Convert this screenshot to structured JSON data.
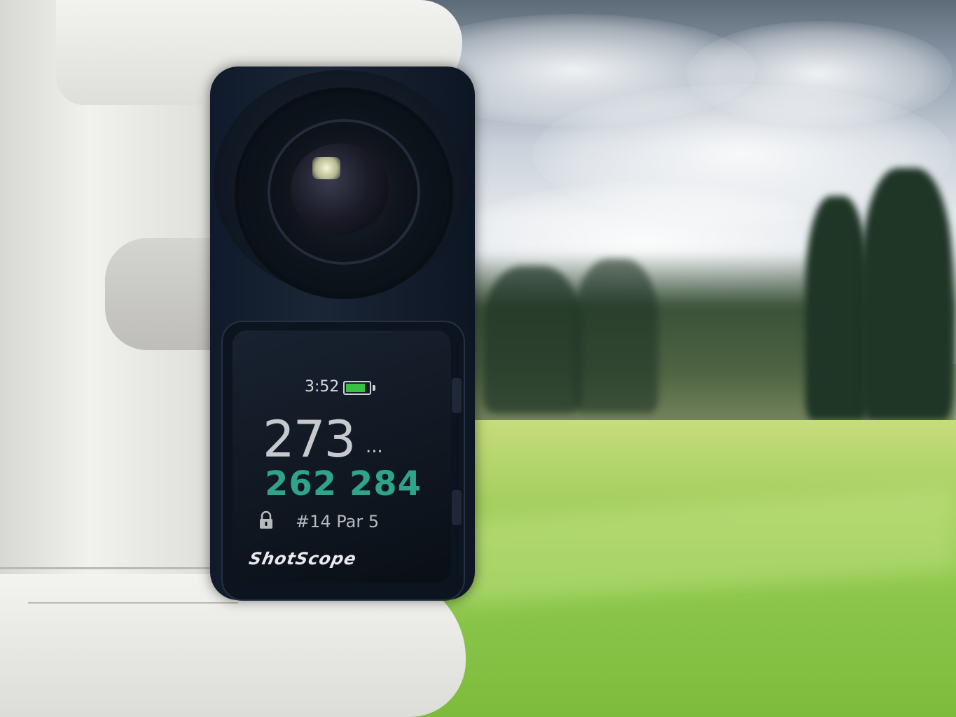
{
  "scene": {
    "description": "",
    "device_brand": "ShotScope"
  },
  "rangefinder": {
    "time": "3:52",
    "battery_level": 0.85,
    "distance": "273",
    "distance_suffix": "...",
    "range_low": "262",
    "range_high": "284",
    "range_text": "262 284",
    "hole_info": "#14 Par 5",
    "brand": "ShotScope",
    "icons": [
      "battery-icon",
      "lock-icon"
    ]
  },
  "colors": {
    "accent": "#2fa48b",
    "battery": "#38c244",
    "display_text": "#c7cacd"
  }
}
